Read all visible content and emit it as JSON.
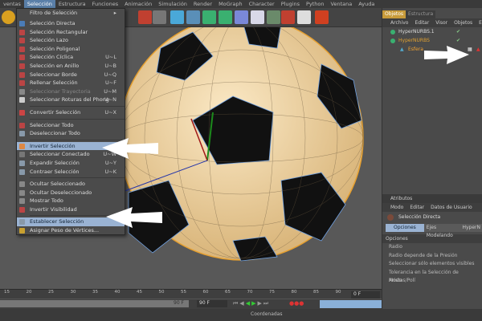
{
  "menubar": [
    "ventas",
    "Selección",
    "Estructura",
    "Funciones",
    "Animación",
    "Simulación",
    "Render",
    "MoGraph",
    "Character",
    "Plugins",
    "Python",
    "Ventana",
    "Ayuda"
  ],
  "menu": {
    "items": [
      {
        "label": "Filtro de Selección",
        "shortcut": "▸"
      },
      {
        "label": "Selección Directa",
        "shortcut": ""
      },
      {
        "label": "Selección Rectangular",
        "shortcut": ""
      },
      {
        "label": "Selección Lazo",
        "shortcut": ""
      },
      {
        "label": "Selección Poligonal",
        "shortcut": ""
      },
      {
        "label": "Selección Cíclica",
        "shortcut": "U~L"
      },
      {
        "label": "Selección en Anillo",
        "shortcut": "U~B"
      },
      {
        "label": "Seleccionar Borde",
        "shortcut": "U~Q"
      },
      {
        "label": "Rellenar Selección",
        "shortcut": "U~F"
      },
      {
        "label": "Seleccionar Trayectoria",
        "shortcut": "U~M"
      },
      {
        "label": "Seleccionar Roturas del Phong",
        "shortcut": "U~N"
      },
      {
        "label": "Convertir Selección",
        "shortcut": "U~X"
      },
      {
        "label": "Seleccionar Todo",
        "shortcut": ""
      },
      {
        "label": "Deseleccionar Todo",
        "shortcut": ""
      },
      {
        "label": "Invertir Selección",
        "shortcut": ""
      },
      {
        "label": "Seleccionar Conectado",
        "shortcut": "U~W"
      },
      {
        "label": "Expandir Selección",
        "shortcut": "U~Y"
      },
      {
        "label": "Contraer Selección",
        "shortcut": "U~K"
      },
      {
        "label": "Ocultar Seleccionado",
        "shortcut": ""
      },
      {
        "label": "Ocultar Deseleccionado",
        "shortcut": ""
      },
      {
        "label": "Mostrar Todo",
        "shortcut": ""
      },
      {
        "label": "Invertir Visibilidad",
        "shortcut": ""
      },
      {
        "label": "Establecer Selección",
        "shortcut": ""
      },
      {
        "label": "Asignar Peso de Vértices...",
        "shortcut": ""
      }
    ]
  },
  "objects": {
    "tabs": [
      "Objetos",
      "Estructura"
    ],
    "menu": [
      "Archivo",
      "Editar",
      "Visor",
      "Objetos",
      "Et"
    ],
    "items": [
      "HyperNURBS.1",
      "HyperNURBS",
      "Esfera"
    ]
  },
  "attributes": {
    "title": "Atributos",
    "menu": [
      "Modo",
      "Editar",
      "Datos de Usuario"
    ],
    "tool": "Selección Directa",
    "tabs": [
      "Opciones",
      "Ejes Modelando",
      "HyperN"
    ],
    "section": "Opciones",
    "fields": [
      "Radio",
      "Radio depende de la Presión",
      "Seleccionar sólo elementos visibles",
      "Tolerancia en la Selección de Aristas/Polí",
      "Modo"
    ]
  },
  "timeline": {
    "ticks": [
      "15",
      "20",
      "25",
      "30",
      "35",
      "40",
      "45",
      "50",
      "55",
      "60",
      "65",
      "70",
      "75",
      "80",
      "85",
      "90"
    ],
    "current": "0 F",
    "end_a": "90 F",
    "end_b": "90 F"
  },
  "bottom": {
    "coords": "Coordenadas"
  },
  "colors": {
    "accent": "#5a7fa8",
    "highlight": "#9ab3d3",
    "ball": "#f3d9a8",
    "tab_active": "#c89b3a"
  }
}
